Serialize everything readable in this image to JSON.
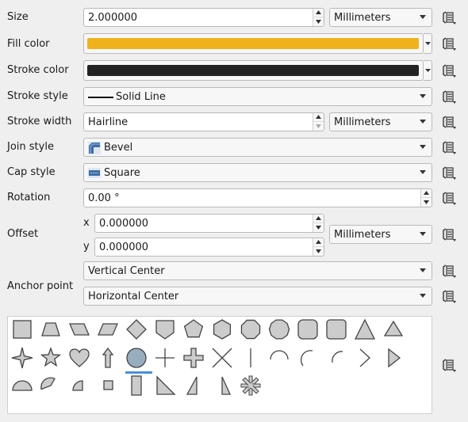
{
  "labels": {
    "size": "Size",
    "fill_color": "Fill color",
    "stroke_color": "Stroke color",
    "stroke_style": "Stroke style",
    "stroke_width": "Stroke width",
    "join_style": "Join style",
    "cap_style": "Cap style",
    "rotation": "Rotation",
    "offset": "Offset",
    "offset_x": "x",
    "offset_y": "y",
    "anchor_point": "Anchor point"
  },
  "values": {
    "size": "2.000000",
    "size_unit": "Millimeters",
    "stroke_style": "Solid Line",
    "stroke_width": "Hairline",
    "stroke_width_unit": "Millimeters",
    "join_style": "Bevel",
    "cap_style": "Square",
    "rotation": "0.00 °",
    "offset_x": "0.000000",
    "offset_y": "0.000000",
    "offset_unit": "Millimeters",
    "anchor_vertical": "Vertical Center",
    "anchor_horizontal": "Horizontal Center"
  },
  "colors": {
    "fill": "#f0b21b",
    "stroke": "#232323",
    "shape_fill": "#cccccc",
    "selected_shape_fill": "#97adc0",
    "selection_bar": "#4a90d9"
  },
  "icons": {
    "data_defined_override": "data-defined-override-icon",
    "join_style": "bevel-join-icon",
    "cap_style": "square-cap-icon"
  },
  "shapes": {
    "selected": "circle",
    "rows": [
      [
        "square",
        "trapezoid",
        "parallelogram-left",
        "parallelogram-right",
        "diamond",
        "shield",
        "pentagon",
        "hexagon",
        "octagon",
        "decagon",
        "rounded-square-octagon",
        "rounded-square",
        "triangle",
        "equilateral-triangle"
      ],
      [
        "star-four-point",
        "star",
        "heart",
        "arrow",
        "circle",
        "cross",
        "cross-fill",
        "cross-x",
        "line",
        "arc",
        "semi-arc",
        "third-arc",
        "arrowhead",
        "filled-arrowhead"
      ],
      [
        "half-circle",
        "third-circle",
        "quarter-circle",
        "quarter-square",
        "half-square",
        "right-half-triangle",
        "left-half-triangle",
        "diagonal-half-square",
        "asterisk-fill"
      ]
    ]
  }
}
